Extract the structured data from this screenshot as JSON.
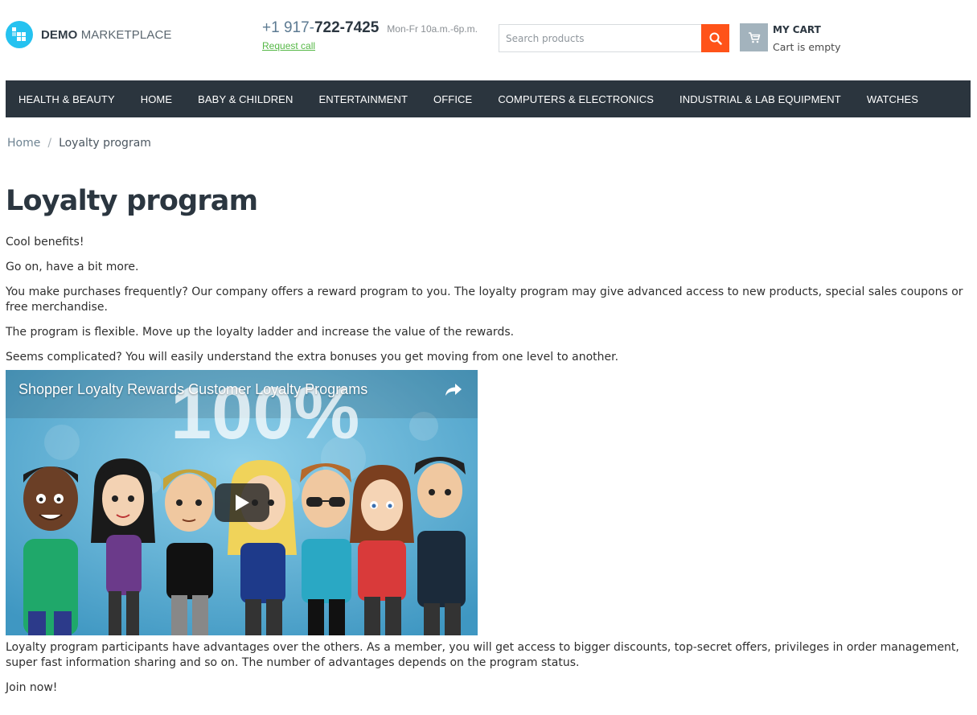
{
  "logo": {
    "text_bold": "DEMO",
    "text_light": "MARKETPLACE",
    "icon": "grid-logo-icon",
    "brand_color": "#25c2f0"
  },
  "contact": {
    "phone_prefix": "+1 917-",
    "phone_main": "722-7425",
    "hours": "Mon-Fr 10a.m.-6p.m.",
    "request_call": "Request call",
    "link_color": "#56b847"
  },
  "search": {
    "placeholder": "Search products",
    "value": "",
    "button_icon": "search-icon",
    "button_color": "#ff5319"
  },
  "cart": {
    "title": "MY CART",
    "status": "Cart is empty",
    "icon": "cart-icon"
  },
  "nav": {
    "background": "#2b353e",
    "items": [
      "HEALTH & BEAUTY",
      "HOME",
      "BABY & CHILDREN",
      "ENTERTAINMENT",
      "OFFICE",
      "COMPUTERS & ELECTRONICS",
      "INDUSTRIAL & LAB EQUIPMENT",
      "WATCHES"
    ]
  },
  "breadcrumb": {
    "home": "Home",
    "separator": "/",
    "current": "Loyalty program"
  },
  "page": {
    "title": "Loyalty program",
    "paragraphs_before_video": [
      "Cool benefits!",
      "Go on, have a bit more.",
      "You make purchases frequently? Our company offers a reward program to you. The loyalty program may give advanced access to new products, special sales coupons or free merchandise.",
      "The program is flexible. Move up the loyalty ladder and increase the value of the rewards.",
      "Seems complicated? You will easily understand the extra bonuses you get moving from one level to another."
    ],
    "paragraphs_after_video": [
      "Loyalty program participants have advantages over the others. As a member, you will get access to bigger discounts, top-secret offers, privileges in order management, super fast information sharing and so on. The number of advantages depends on the program status.",
      "Join now!"
    ]
  },
  "video": {
    "title": "Shopper Loyalty Rewards Customer Loyalty Programs",
    "overlay_text": "100%",
    "share_icon": "share-icon",
    "play_icon": "play-icon"
  }
}
